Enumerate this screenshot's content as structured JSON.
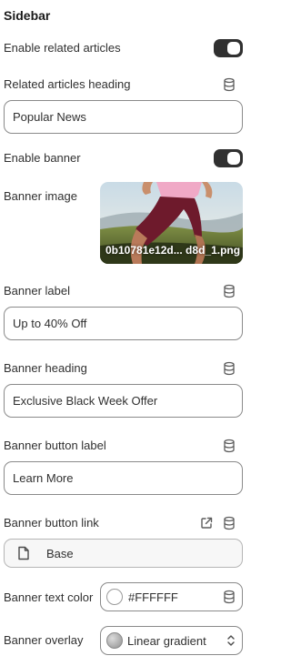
{
  "panel": {
    "title": "Sidebar"
  },
  "settings": {
    "enable_related": {
      "label": "Enable related articles",
      "on": true
    },
    "related_heading": {
      "label": "Related articles heading",
      "value": "Popular News"
    },
    "enable_banner": {
      "label": "Enable banner",
      "on": true
    },
    "banner_image": {
      "label": "Banner image",
      "filename": "0b10781e12d... d8d_1.png"
    },
    "banner_label": {
      "label": "Banner label",
      "value": "Up to 40% Off"
    },
    "banner_heading": {
      "label": "Banner heading",
      "value": "Exclusive Black Week Offer"
    },
    "banner_button_label": {
      "label": "Banner button label",
      "value": "Learn More"
    },
    "banner_button_link": {
      "label": "Banner button link",
      "value": "Base"
    },
    "banner_text_color": {
      "label": "Banner text color",
      "value": "#FFFFFF",
      "swatch": "#FFFFFF"
    },
    "banner_overlay": {
      "label": "Banner overlay",
      "value": "Linear gradient"
    }
  },
  "icons": {
    "dynamic_source": "database-icon",
    "external_link": "external-link-icon",
    "page": "page-icon",
    "select": "chevron-up-down-icon"
  },
  "colors": {
    "toggle_on": "#303030",
    "border": "#8a8a8a",
    "text": "#303030"
  }
}
